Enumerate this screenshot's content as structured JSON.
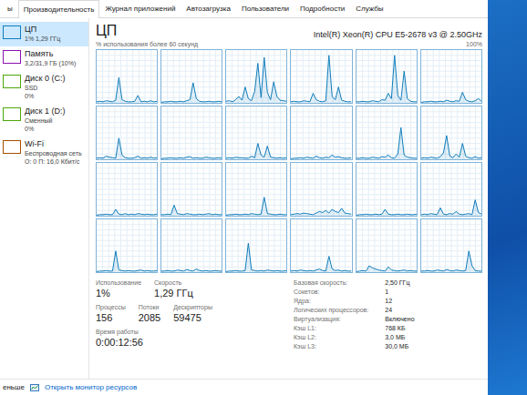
{
  "tabs": [
    {
      "label": "ы",
      "selected": false
    },
    {
      "label": "Производительность",
      "selected": true
    },
    {
      "label": "Журнал приложений",
      "selected": false
    },
    {
      "label": "Автозагрузка",
      "selected": false
    },
    {
      "label": "Пользователи",
      "selected": false
    },
    {
      "label": "Подробности",
      "selected": false
    },
    {
      "label": "Службы",
      "selected": false
    }
  ],
  "sidebar": {
    "items": [
      {
        "title": "ЦП",
        "lines": [
          "1% 1,29 ГГц"
        ],
        "selected": true,
        "color": "#117dbb"
      },
      {
        "title": "Память",
        "lines": [
          "3,2/31,9 ГБ (10%)"
        ],
        "selected": false,
        "color": "#8b12ae"
      },
      {
        "title": "Диск 0 (C:)",
        "lines": [
          "SSD",
          "0%"
        ],
        "selected": false,
        "color": "#4da60c"
      },
      {
        "title": "Диск 1 (D:)",
        "lines": [
          "Сменный",
          "0%"
        ],
        "selected": false,
        "color": "#4da60c"
      },
      {
        "title": "Wi-Fi",
        "lines": [
          "Беспроводная сеть",
          "О: 0 П: 16,0 Кбит/с"
        ],
        "selected": false,
        "color": "#a74f01"
      }
    ]
  },
  "cpu": {
    "title": "ЦП",
    "model": "Intel(R) Xeon(R) CPU E5-2678 v3 @ 2.50GHz",
    "chart_caption": "% использования более 60 секунд",
    "chart_max": "100%",
    "processors": [
      [
        2,
        3,
        2,
        4,
        3,
        2,
        5,
        48,
        6,
        3,
        2,
        2,
        3,
        14,
        2,
        3,
        2,
        4,
        2,
        3
      ],
      [
        1,
        2,
        2,
        3,
        2,
        2,
        3,
        2,
        4,
        6,
        38,
        8,
        3,
        2,
        2,
        3,
        2,
        2,
        3,
        2
      ],
      [
        3,
        4,
        2,
        6,
        12,
        5,
        30,
        8,
        4,
        22,
        75,
        10,
        86,
        20,
        6,
        40,
        12,
        5,
        4,
        3
      ],
      [
        2,
        3,
        2,
        2,
        4,
        3,
        2,
        18,
        6,
        3,
        2,
        4,
        90,
        12,
        6,
        30,
        5,
        3,
        2,
        2
      ],
      [
        2,
        2,
        3,
        2,
        2,
        4,
        3,
        2,
        6,
        5,
        18,
        8,
        90,
        14,
        5,
        60,
        8,
        3,
        2,
        2
      ],
      [
        1,
        2,
        2,
        3,
        2,
        2,
        3,
        2,
        5,
        3,
        2,
        4,
        3,
        20,
        6,
        3,
        2,
        4,
        8,
        3
      ],
      [
        2,
        3,
        2,
        6,
        4,
        3,
        2,
        40,
        8,
        3,
        2,
        2,
        3,
        6,
        2,
        3,
        2,
        4,
        2,
        3
      ],
      [
        1,
        2,
        2,
        3,
        2,
        2,
        3,
        2,
        4,
        5,
        2,
        3,
        2,
        2,
        4,
        3,
        2,
        2,
        3,
        2
      ],
      [
        2,
        3,
        2,
        4,
        3,
        3,
        2,
        2,
        6,
        3,
        30,
        8,
        4,
        25,
        4,
        3,
        2,
        3,
        2,
        3
      ],
      [
        1,
        2,
        2,
        3,
        2,
        4,
        3,
        2,
        6,
        3,
        2,
        4,
        3,
        8,
        4,
        5,
        3,
        2,
        2,
        3
      ],
      [
        2,
        2,
        3,
        2,
        2,
        4,
        3,
        2,
        5,
        4,
        8,
        3,
        2,
        10,
        60,
        8,
        4,
        3,
        2,
        2
      ],
      [
        2,
        3,
        2,
        4,
        3,
        2,
        5,
        12,
        45,
        6,
        3,
        10,
        4,
        30,
        6,
        3,
        2,
        5,
        2,
        3
      ],
      [
        1,
        2,
        2,
        3,
        2,
        2,
        12,
        3,
        2,
        4,
        2,
        3,
        2,
        4,
        3,
        2,
        3,
        2,
        2,
        3
      ],
      [
        2,
        2,
        3,
        2,
        20,
        4,
        3,
        2,
        4,
        3,
        2,
        2,
        3,
        2,
        3,
        4,
        2,
        3,
        2,
        2
      ],
      [
        1,
        2,
        2,
        3,
        2,
        2,
        3,
        2,
        4,
        3,
        2,
        3,
        35,
        4,
        3,
        2,
        2,
        3,
        2,
        2
      ],
      [
        2,
        3,
        4,
        3,
        5,
        4,
        3,
        2,
        5,
        8,
        6,
        10,
        5,
        12,
        8,
        6,
        14,
        5,
        4,
        3
      ],
      [
        1,
        2,
        2,
        3,
        2,
        2,
        3,
        2,
        3,
        12,
        3,
        2,
        2,
        3,
        2,
        2,
        3,
        2,
        2,
        3
      ],
      [
        2,
        3,
        2,
        4,
        3,
        2,
        15,
        3,
        2,
        4,
        3,
        8,
        3,
        2,
        3,
        4,
        2,
        30,
        6,
        3
      ],
      [
        1,
        2,
        2,
        3,
        2,
        2,
        40,
        4,
        3,
        2,
        3,
        2,
        2,
        3,
        4,
        2,
        3,
        2,
        2,
        3
      ],
      [
        2,
        2,
        3,
        2,
        2,
        4,
        3,
        2,
        5,
        3,
        2,
        6,
        3,
        2,
        3,
        2,
        2,
        3,
        2,
        2
      ],
      [
        1,
        2,
        2,
        3,
        2,
        2,
        3,
        55,
        4,
        3,
        2,
        3,
        2,
        4,
        3,
        2,
        3,
        2,
        2,
        3
      ],
      [
        2,
        3,
        2,
        4,
        3,
        2,
        3,
        2,
        4,
        6,
        3,
        2,
        30,
        6,
        3,
        4,
        2,
        3,
        2,
        2
      ],
      [
        1,
        2,
        3,
        2,
        12,
        8,
        6,
        4,
        3,
        2,
        10,
        4,
        3,
        2,
        3,
        4,
        2,
        3,
        2,
        2
      ],
      [
        2,
        2,
        3,
        2,
        2,
        4,
        3,
        2,
        5,
        3,
        2,
        4,
        3,
        2,
        3,
        40,
        12,
        3,
        2,
        2
      ]
    ]
  },
  "stats": {
    "rows": [
      [
        {
          "label": "Использование",
          "value": "1%"
        },
        {
          "label": "Скорость",
          "value": "1,29 ГГц"
        }
      ],
      [
        {
          "label": "Процессы",
          "value": "156"
        },
        {
          "label": "Потоки",
          "value": "2085"
        },
        {
          "label": "Дескрипторы",
          "value": "59475"
        }
      ],
      [
        {
          "label": "Время работы",
          "value": "0:00:12:56"
        }
      ]
    ]
  },
  "details": [
    {
      "label": "Базовая скорость:",
      "value": "2,50 ГГц"
    },
    {
      "label": "Сокетов:",
      "value": "1"
    },
    {
      "label": "Ядра:",
      "value": "12"
    },
    {
      "label": "Логических процессоров:",
      "value": "24"
    },
    {
      "label": "Виртуализация:",
      "value": "Включено"
    },
    {
      "label": "Кэш L1:",
      "value": "768 КБ"
    },
    {
      "label": "Кэш L2:",
      "value": "3,0 МБ"
    },
    {
      "label": "Кэш L3:",
      "value": "30,0 МБ"
    }
  ],
  "footer": {
    "less": "еньше",
    "monitor_link": "Открыть монитор ресурсов"
  }
}
